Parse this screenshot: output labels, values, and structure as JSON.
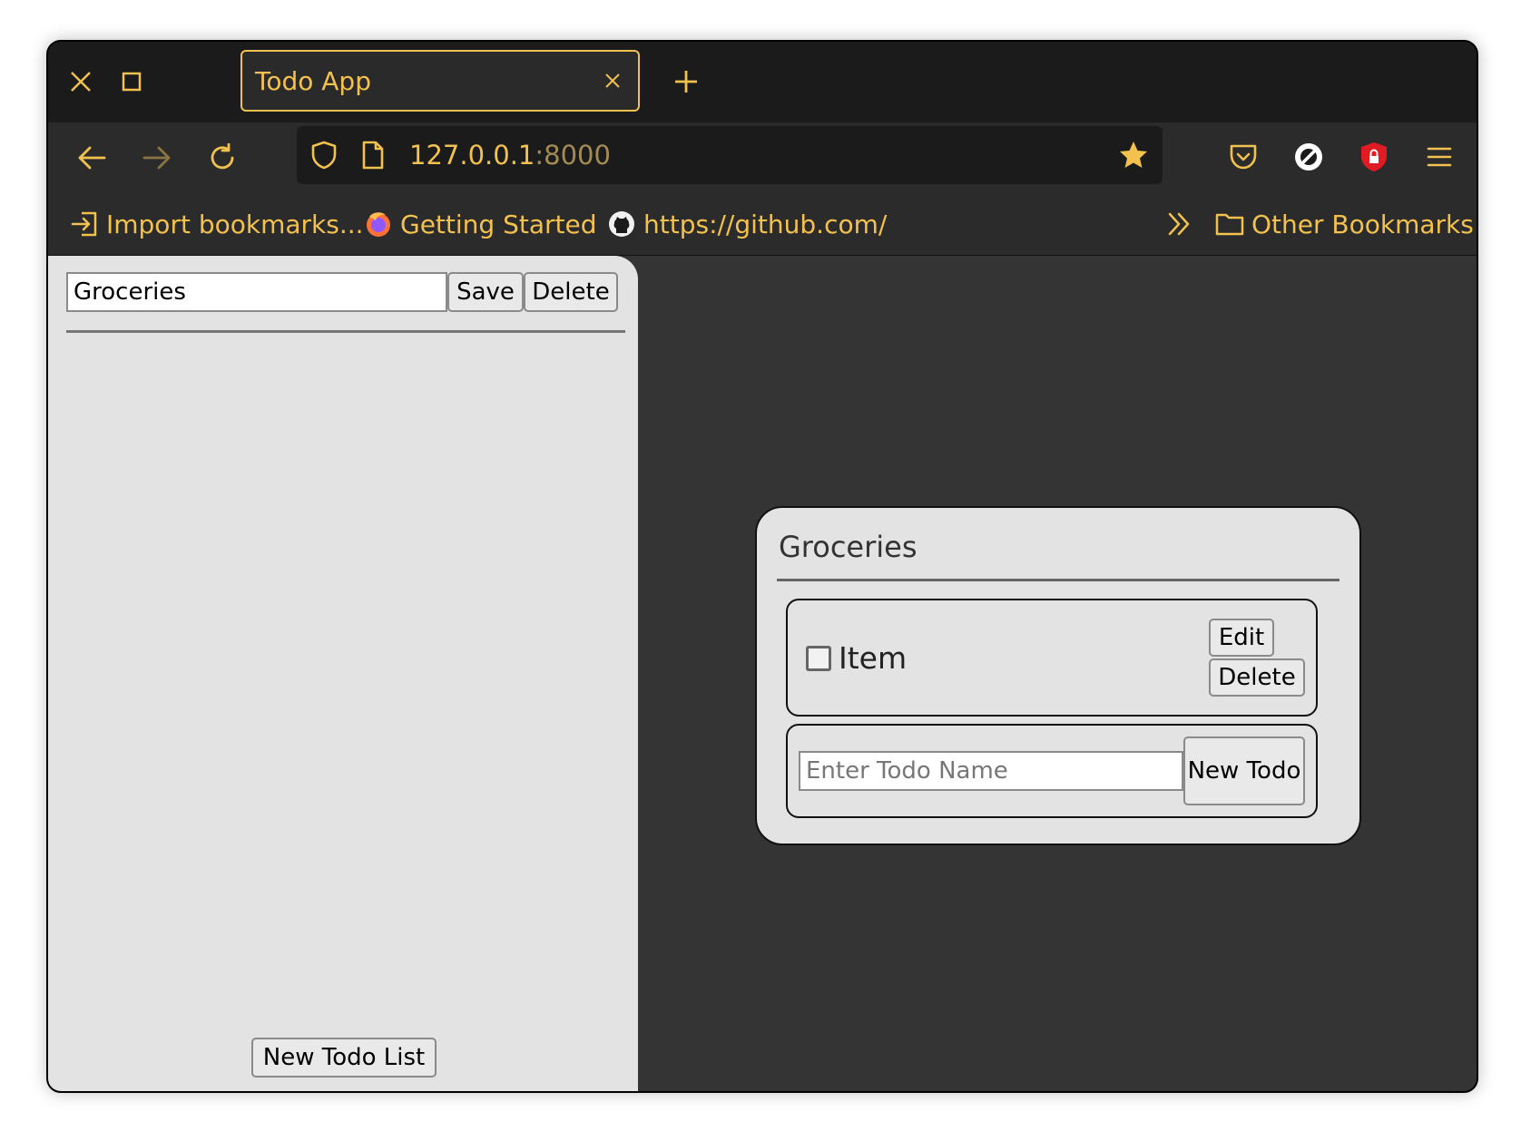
{
  "browser": {
    "tab_title": "Todo App",
    "url_host": "127.0.0.1",
    "url_port": ":8000",
    "bookmarks": {
      "import": "Import bookmarks...",
      "getting_started": "Getting Started",
      "github": "https://github.com/",
      "other": "Other Bookmarks"
    },
    "colors": {
      "accent": "#f2c14e",
      "chrome_dark": "#1b1b1b",
      "chrome": "#2b2b2b"
    }
  },
  "sidebar": {
    "list_name_value": "Groceries",
    "save_label": "Save",
    "delete_label": "Delete",
    "new_list_label": "New Todo List"
  },
  "list_card": {
    "title": "Groceries",
    "items": [
      {
        "label": "Item",
        "checked": false,
        "edit_label": "Edit",
        "delete_label": "Delete"
      }
    ],
    "new_todo_placeholder": "Enter Todo Name",
    "new_todo_label": "New Todo"
  }
}
